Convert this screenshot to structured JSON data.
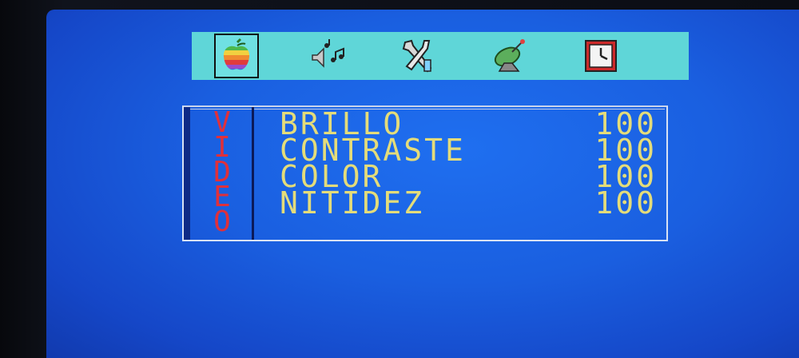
{
  "menu": {
    "tabs": [
      {
        "icon": "apple-icon",
        "selected": true
      },
      {
        "icon": "music-speaker-icon",
        "selected": false
      },
      {
        "icon": "tools-icon",
        "selected": false
      },
      {
        "icon": "satellite-dish-icon",
        "selected": false
      },
      {
        "icon": "clock-icon",
        "selected": false
      }
    ],
    "accent": "#5fd6d8"
  },
  "panel": {
    "section_title": [
      "V",
      "I",
      "D",
      "E",
      "O"
    ],
    "section_color": "#e0303a",
    "text_color": "#e4dc7a",
    "items": [
      {
        "label": "BRILLO",
        "value": "100"
      },
      {
        "label": "CONTRASTE",
        "value": "100"
      },
      {
        "label": "COLOR",
        "value": "100"
      },
      {
        "label": "NITIDEZ",
        "value": "100"
      }
    ]
  }
}
